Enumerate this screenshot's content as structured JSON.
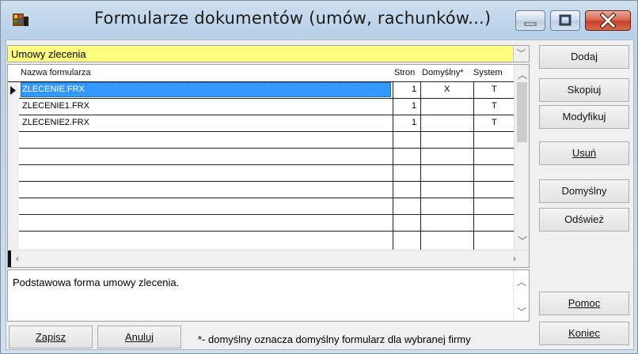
{
  "window": {
    "title": "Formularze dokumentów (umów, rachunków...)",
    "icons": {
      "app": "app-window-icon",
      "minimize": "minimize-icon",
      "maximize": "maximize-icon",
      "close": "close-icon"
    },
    "colors": {
      "combo_bg": "#ffff80",
      "selection": "#3399ff",
      "close_red": "#c7402a"
    }
  },
  "category": {
    "selected": "Umowy zlecenia"
  },
  "grid": {
    "columns": [
      "Nazwa formularza",
      "Stron",
      "Domyślny*",
      "System"
    ],
    "rows": [
      {
        "name": "ZLECENIE.FRX",
        "pages": "1",
        "default": "X",
        "system": "T",
        "selected": true
      },
      {
        "name": "ZLECENIE1.FRX",
        "pages": "1",
        "default": "",
        "system": "T",
        "selected": false
      },
      {
        "name": "ZLECENIE2.FRX",
        "pages": "1",
        "default": "",
        "system": "T",
        "selected": false
      }
    ]
  },
  "description": "Podstawowa forma umowy zlecenia.",
  "buttons": {
    "add": "Dodaj",
    "copy": "Skopiuj",
    "modify": "Modyfikuj",
    "delete": "Usuń",
    "set_default": "Domyślny",
    "refresh": "Odśwież",
    "help": "Pomoc",
    "close": "Koniec",
    "save": "Zapisz",
    "cancel": "Anuluj"
  },
  "note": "*- domyślny oznacza domyślny formularz dla wybranej firmy"
}
